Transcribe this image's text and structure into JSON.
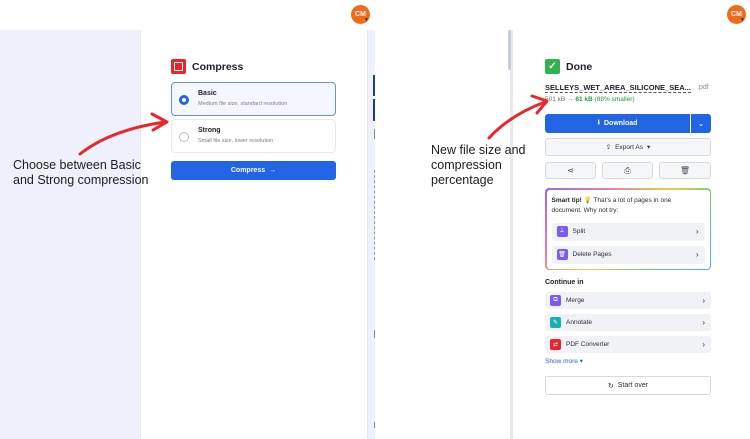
{
  "colors": {
    "accent": "#2165e5",
    "arrow": "#e8262b",
    "avatar": "#f26b1d",
    "success": "#1e9e3e"
  },
  "left": {
    "avatar_initials": "CM",
    "tool_title": "Compress",
    "options": [
      {
        "title": "Basic",
        "subtitle": "Medium file size, standard resolution",
        "selected": true
      },
      {
        "title": "Strong",
        "subtitle": "Small file size, lower resolution",
        "selected": false
      }
    ],
    "compress_button": "Compress",
    "annotation": [
      "Choose between Basic",
      "and Strong compression"
    ]
  },
  "right": {
    "avatar_initials": "CM",
    "done_title": "Done",
    "file_name": "SELLEYS_WET_AREA_SILICONE_SEA...",
    "file_ext": ".pdf",
    "size_old": "501 kB",
    "size_arrow": "→",
    "size_new": "61 kB",
    "size_pct": "(88% smaller)",
    "download_button": "Download",
    "export_button": "Export As",
    "tip": {
      "label": "Smart tip!",
      "text": "That's a lot of pages in one document. Why not try:",
      "items": [
        "Split",
        "Delete Pages"
      ]
    },
    "continue_label": "Continue in",
    "continue_items": [
      "Merge",
      "Annotate",
      "PDF Converter"
    ],
    "show_more": "Show more",
    "start_over": "Start over",
    "annotation": [
      "New file size and",
      "compression",
      "percentage"
    ]
  },
  "icons": {
    "share": "share-icon",
    "print": "print-icon",
    "delete": "trash-icon"
  }
}
